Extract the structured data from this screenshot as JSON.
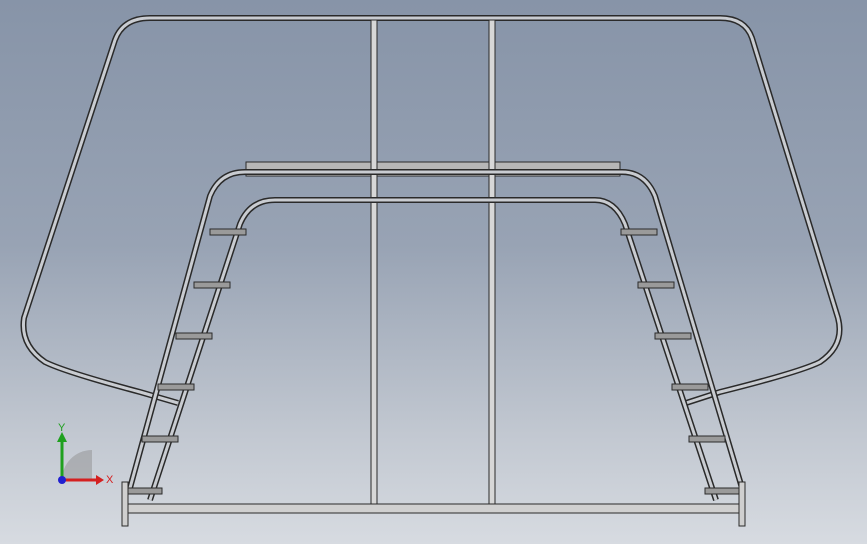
{
  "window": {
    "title": ""
  },
  "viewport": {
    "background_top": "#8794a8",
    "background_bottom": "#d7dbe1"
  },
  "model": {
    "name": "",
    "edge_color": "#2a2a2a",
    "steel_color": "#c8c8c8",
    "tread_color": "#9a9a9a"
  },
  "triad": {
    "x_label": "X",
    "y_label": "Y",
    "x_color": "#d42020",
    "y_color": "#1fa01f",
    "z_color": "#2020d0"
  }
}
